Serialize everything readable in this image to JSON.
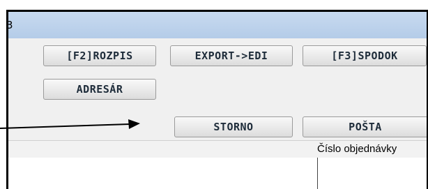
{
  "window": {
    "title_fragment": "3"
  },
  "toolbar": {
    "rozpis": "[F2]ROZPIS",
    "export_edi": "EXPORT->EDI",
    "spodok": "[F3]SPODOK",
    "adresar": "ADRESÁR",
    "storno": "STORNO",
    "posta": "POŠTA"
  },
  "table": {
    "column_header": "Číslo objednávky"
  },
  "annotation": {
    "arrow_color": "#000000"
  }
}
